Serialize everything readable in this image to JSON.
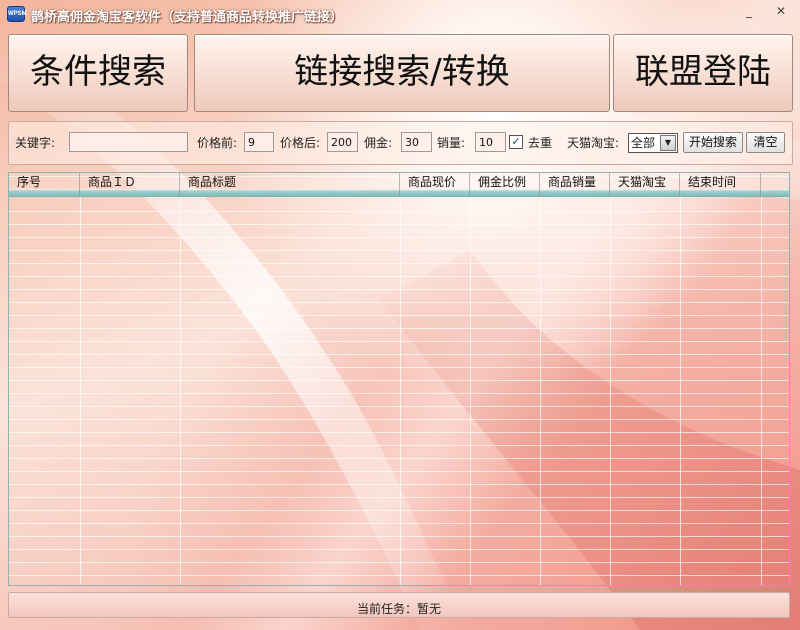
{
  "window": {
    "icon_label": "WPSM",
    "title": "鹊桥高佣金淘宝客软件（支持普通商品转换推广链接）",
    "min_glyph": "_",
    "max_glyph": "□",
    "close_glyph": "✕"
  },
  "toolbar": {
    "condition_search": "条件搜索",
    "link_search": "链接搜索/转换",
    "alliance_login": "联盟登陆"
  },
  "filters": {
    "keyword_label": "关键字:",
    "keyword_value": "",
    "price_min_label": "价格前:",
    "price_min_value": "9",
    "price_max_label": "价格后:",
    "price_max_value": "200",
    "commission_label": "佣金:",
    "commission_value": "30",
    "sales_label": "销量:",
    "sales_value": "10",
    "dedupe_label": "去重",
    "dedupe_checked": true,
    "platform_label": "天猫淘宝:",
    "platform_selected": "全部",
    "search_button": "开始搜索",
    "clear_button": "清空"
  },
  "table": {
    "columns": [
      "序号",
      "商品ＩＤ",
      "商品标题",
      "商品现价",
      "佣金比例",
      "商品销量",
      "天猫淘宝",
      "结束时间"
    ],
    "rows": []
  },
  "status": {
    "text": "当前任务：暂无"
  }
}
